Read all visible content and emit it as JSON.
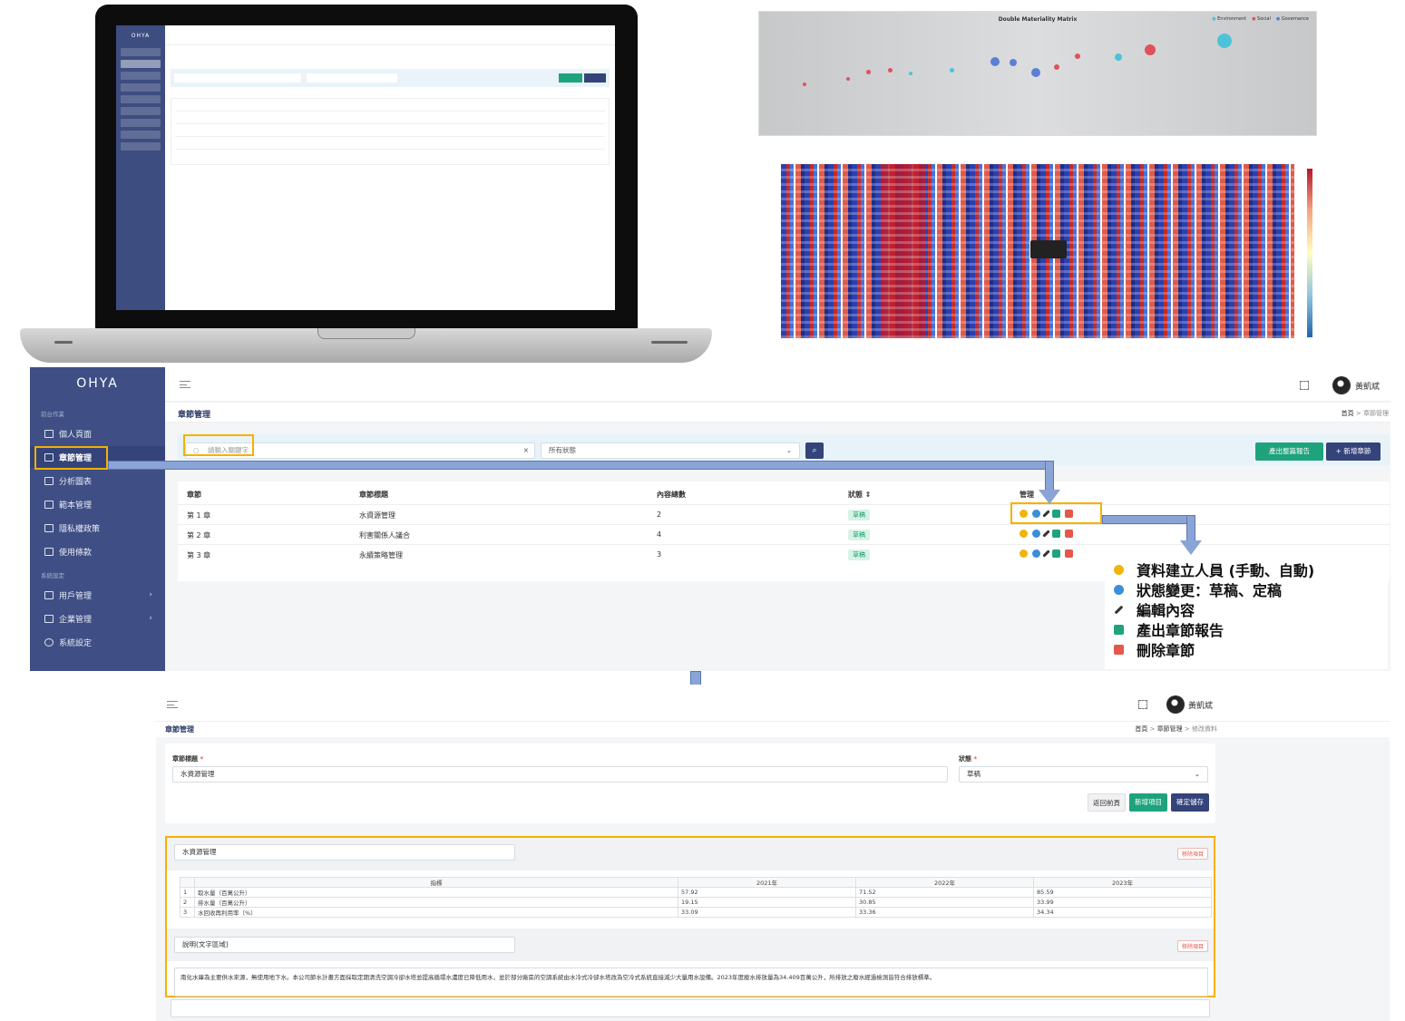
{
  "laptop": {
    "logo": "OHYA"
  },
  "matrix": {
    "title": "Double Materiality Matrix",
    "legend": [
      "Environment",
      "Social",
      "Governance"
    ]
  },
  "app": {
    "logo": "OHYA",
    "section_main": "前台作業",
    "section_system": "系統設定",
    "nav": [
      {
        "label": "個人頁面"
      },
      {
        "label": "章節管理"
      },
      {
        "label": "分析圖表"
      },
      {
        "label": "範本管理"
      },
      {
        "label": "隱私權政策"
      },
      {
        "label": "使用條款"
      },
      {
        "label": "用戶管理",
        "chevron": "›"
      },
      {
        "label": "企業管理",
        "chevron": "›"
      },
      {
        "label": "系統設定"
      }
    ],
    "page_title": "章節管理",
    "breadcrumb_home": "首頁",
    "breadcrumb_sep": ">",
    "breadcrumb_current": "章節管理",
    "username": "黃凱斌",
    "search": {
      "placeholder": "請輸入關鍵字",
      "clear": "×"
    },
    "status_filter": {
      "value": "所有狀態"
    },
    "btn_report": "產出整篇報告",
    "btn_add": "+ 新增章節",
    "table": {
      "headers": [
        "章節",
        "章節標題",
        "內容總數",
        "狀態 ⇕",
        "管理"
      ],
      "rows": [
        {
          "chapter": "第 1 章",
          "title": "水資源管理",
          "count": "2",
          "status": "草稿"
        },
        {
          "chapter": "第 2 章",
          "title": "利害關係人議合",
          "count": "4",
          "status": "草稿"
        },
        {
          "chapter": "第 3 章",
          "title": "永續策略管理",
          "count": "3",
          "status": "草稿"
        }
      ]
    }
  },
  "legend": [
    {
      "icon": "database-icon",
      "color": "#f1b40b",
      "label": "資料建立人員 (手動、自動)"
    },
    {
      "icon": "status-icon",
      "color": "#3a8fd8",
      "label": "狀態變更：草稿、定稿"
    },
    {
      "icon": "pencil-icon",
      "color": "#333333",
      "label": "編輯內容"
    },
    {
      "icon": "report-icon",
      "color": "#1fa37c",
      "label": "產出章節報告"
    },
    {
      "icon": "trash-icon",
      "color": "#e4584a",
      "label": "刪除章節"
    }
  ],
  "edit": {
    "page_title": "章節管理",
    "username": "黃凱斌",
    "breadcrumb": [
      "首頁",
      "章節管理",
      "修改資料"
    ],
    "title_label": "章節標題",
    "title_value": "水資源管理",
    "status_label": "狀態",
    "status_value": "草稿",
    "btn_back": "返回前頁",
    "btn_add_item": "新增項目",
    "btn_save": "確定儲存",
    "section1_name": "水資源管理",
    "remove_label": "移除項目",
    "table_headers": [
      "",
      "指標",
      "2021年",
      "2022年",
      "2023年"
    ],
    "table_rows": [
      [
        "1",
        "取水量（百萬公升）",
        "57.92",
        "71.52",
        "85.59"
      ],
      [
        "2",
        "排水量（百萬公升）",
        "19.15",
        "30.85",
        "33.99"
      ],
      [
        "3",
        "水回收再利用率（%）",
        "33.09",
        "33.36",
        "34.34"
      ]
    ],
    "section2_name": "說明(文字區域)",
    "section2_text": "南化水庫為主要供水來源，無使用地下水。本公司節水計畫方面採取定期清洗空調冷卻水塔並提高循環水濃度已降低用水，並於部分廠區的空調系統由水冷式冷卻水塔改為空冷式系統直接減少大量用水設備。2023年度廢水排放量為34.409百萬公升，所排放之廢水經過檢測皆符合排放標準。"
  }
}
